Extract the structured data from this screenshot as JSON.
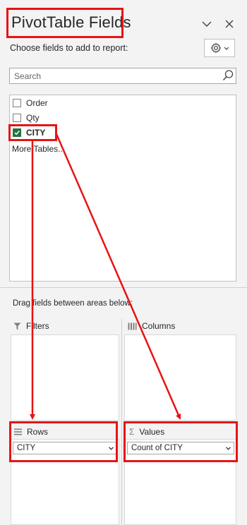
{
  "header": {
    "title": "PivotTable Fields",
    "subtitle": "Choose fields to add to report:"
  },
  "search": {
    "placeholder": "Search"
  },
  "fields": [
    {
      "label": "Order",
      "checked": false
    },
    {
      "label": "Qty",
      "checked": false
    },
    {
      "label": "CITY",
      "checked": true
    }
  ],
  "more_tables": "More Tables...",
  "areas": {
    "drag_label": "Drag fields between areas below:",
    "filters": {
      "label": "Filters"
    },
    "columns": {
      "label": "Columns"
    },
    "rows": {
      "label": "Rows",
      "value": "CITY"
    },
    "values": {
      "label": "Values",
      "value": "Count of CITY"
    }
  },
  "colors": {
    "accent_check": "#217346",
    "annotation_red": "#e81313"
  }
}
